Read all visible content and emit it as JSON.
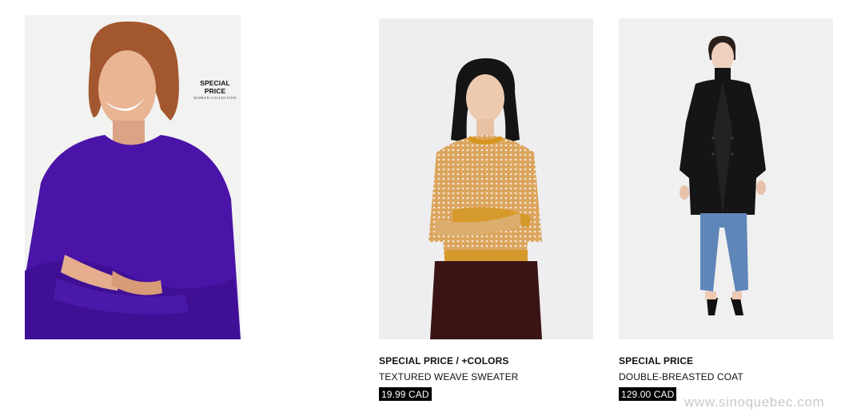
{
  "hero": {
    "tag_title": "SPECIAL PRICE",
    "tag_subtitle": "WOMAN COLLECTION"
  },
  "products": [
    {
      "badge": "SPECIAL PRICE / +COLORS",
      "name": "TEXTURED WEAVE SWEATER",
      "price": "19.99 CAD"
    },
    {
      "badge": "SPECIAL PRICE",
      "name": "DOUBLE-BREASTED COAT",
      "price": "129.00 CAD"
    }
  ],
  "watermark": "www.sinoquebec.com",
  "colors": {
    "sweater_purple": "#4a14a8",
    "sweater_mustard": "#d69a2c",
    "coat_black": "#151515",
    "jeans_blue": "#5f86b8",
    "price_bg": "#000000"
  }
}
